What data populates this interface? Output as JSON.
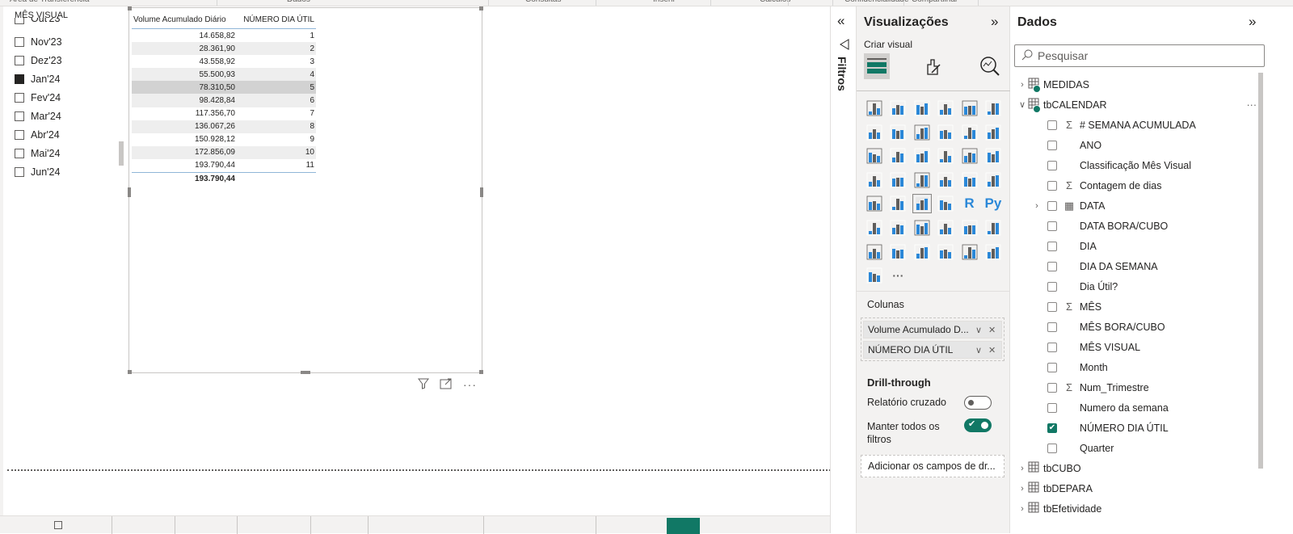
{
  "ribbon": [
    "Área de Transferência",
    "Dados",
    "Consultas",
    "Inserir",
    "Cálculos",
    "Confidencialidade",
    "Compartilhar"
  ],
  "slicer": {
    "title": "MÊS VISUAL",
    "items": [
      {
        "label": "Out'23",
        "checked": false
      },
      {
        "label": "Nov'23",
        "checked": false
      },
      {
        "label": "Dez'23",
        "checked": false
      },
      {
        "label": "Jan'24",
        "checked": true
      },
      {
        "label": "Fev'24",
        "checked": false
      },
      {
        "label": "Mar'24",
        "checked": false
      },
      {
        "label": "Abr'24",
        "checked": false
      },
      {
        "label": "Mai'24",
        "checked": false
      },
      {
        "label": "Jun'24",
        "checked": false
      }
    ]
  },
  "table": {
    "headers": [
      "Volume Acumulado Diário",
      "NÚMERO DIA ÚTIL"
    ],
    "rows": [
      [
        "14.658,82",
        "1"
      ],
      [
        "28.361,90",
        "2"
      ],
      [
        "43.558,92",
        "3"
      ],
      [
        "55.500,93",
        "4"
      ],
      [
        "78.310,50",
        "5"
      ],
      [
        "98.428,84",
        "6"
      ],
      [
        "117.356,70",
        "7"
      ],
      [
        "136.067,26",
        "8"
      ],
      [
        "150.928,12",
        "9"
      ],
      [
        "172.856,09",
        "10"
      ],
      [
        "193.790,44",
        "11"
      ]
    ],
    "selected_row": 4,
    "total": "193.790,44"
  },
  "filters": {
    "label": "Filtros"
  },
  "viz": {
    "title": "Visualizações",
    "create_visual": "Criar visual",
    "icons": [
      "stacked-bar",
      "stacked-column",
      "clustered-bar",
      "clustered-column",
      "100-bar",
      "100-column",
      "line",
      "area",
      "stacked-area",
      "line-clustered-column",
      "line-stacked-column",
      "ribbon",
      "waterfall",
      "funnel",
      "scatter",
      "pie",
      "donut",
      "treemap",
      "map",
      "filled-map",
      "azure-map",
      "gauge",
      "card",
      "multi-row-card",
      "kpi",
      "slicer",
      "table",
      "matrix",
      "R",
      "Py",
      "key-influencers",
      "decomposition-tree",
      "qna",
      "smart-narrative",
      "trophy",
      "paginated",
      "power-kpi",
      "power-slicer",
      "power-apps",
      "power-automate",
      "deneb",
      "html-content",
      "pro-visual",
      "more"
    ],
    "columns_label": "Colunas",
    "columns": [
      "Volume Acumulado D...",
      "NÚMERO DIA ÚTIL"
    ],
    "drill_label": "Drill-through",
    "cross_report": "Relatório cruzado",
    "cross_report_on": false,
    "keep_filters": "Manter todos os filtros",
    "keep_filters_on": true,
    "add_fields": "Adicionar os campos de dr..."
  },
  "data": {
    "title": "Dados",
    "search_placeholder": "Pesquisar",
    "tree": [
      {
        "label": "MEDIDAS",
        "type": "table",
        "expand": "collapsed",
        "badge": true
      },
      {
        "label": "tbCALENDAR",
        "type": "table",
        "expand": "expanded",
        "badge": true,
        "more": "···"
      },
      {
        "label": "# SEMANA ACUMULADA",
        "type": "field",
        "sigma": true,
        "checked": false
      },
      {
        "label": "ANO",
        "type": "field",
        "checked": false
      },
      {
        "label": "Classificação Mês Visual",
        "type": "field",
        "checked": false
      },
      {
        "label": "Contagem de dias",
        "type": "field",
        "sigma": true,
        "checked": false
      },
      {
        "label": "DATA",
        "type": "field",
        "calendar": true,
        "expand": "collapsed",
        "checked": false
      },
      {
        "label": "DATA BORA/CUBO",
        "type": "field",
        "checked": false
      },
      {
        "label": "DIA",
        "type": "field",
        "checked": false
      },
      {
        "label": "DIA DA SEMANA",
        "type": "field",
        "checked": false
      },
      {
        "label": "Dia Útil?",
        "type": "field",
        "checked": false
      },
      {
        "label": "MÊS",
        "type": "field",
        "sigma": true,
        "checked": false
      },
      {
        "label": "MÊS BORA/CUBO",
        "type": "field",
        "checked": false
      },
      {
        "label": "MÊS VISUAL",
        "type": "field",
        "checked": false
      },
      {
        "label": "Month",
        "type": "field",
        "checked": false
      },
      {
        "label": "Num_Trimestre",
        "type": "field",
        "sigma": true,
        "checked": false
      },
      {
        "label": "Numero da semana",
        "type": "field",
        "checked": false
      },
      {
        "label": "NÚMERO DIA ÚTIL",
        "type": "field",
        "checked": true
      },
      {
        "label": "Quarter",
        "type": "field",
        "checked": false
      },
      {
        "label": "tbCUBO",
        "type": "table",
        "expand": "collapsed"
      },
      {
        "label": "tbDEPARA",
        "type": "table",
        "expand": "collapsed"
      },
      {
        "label": "tbEfetividade",
        "type": "table",
        "expand": "collapsed"
      }
    ]
  },
  "colors": {
    "accent": "#117865",
    "header_line": "#8fb6d8",
    "icon_blue": "#2b88d8"
  }
}
